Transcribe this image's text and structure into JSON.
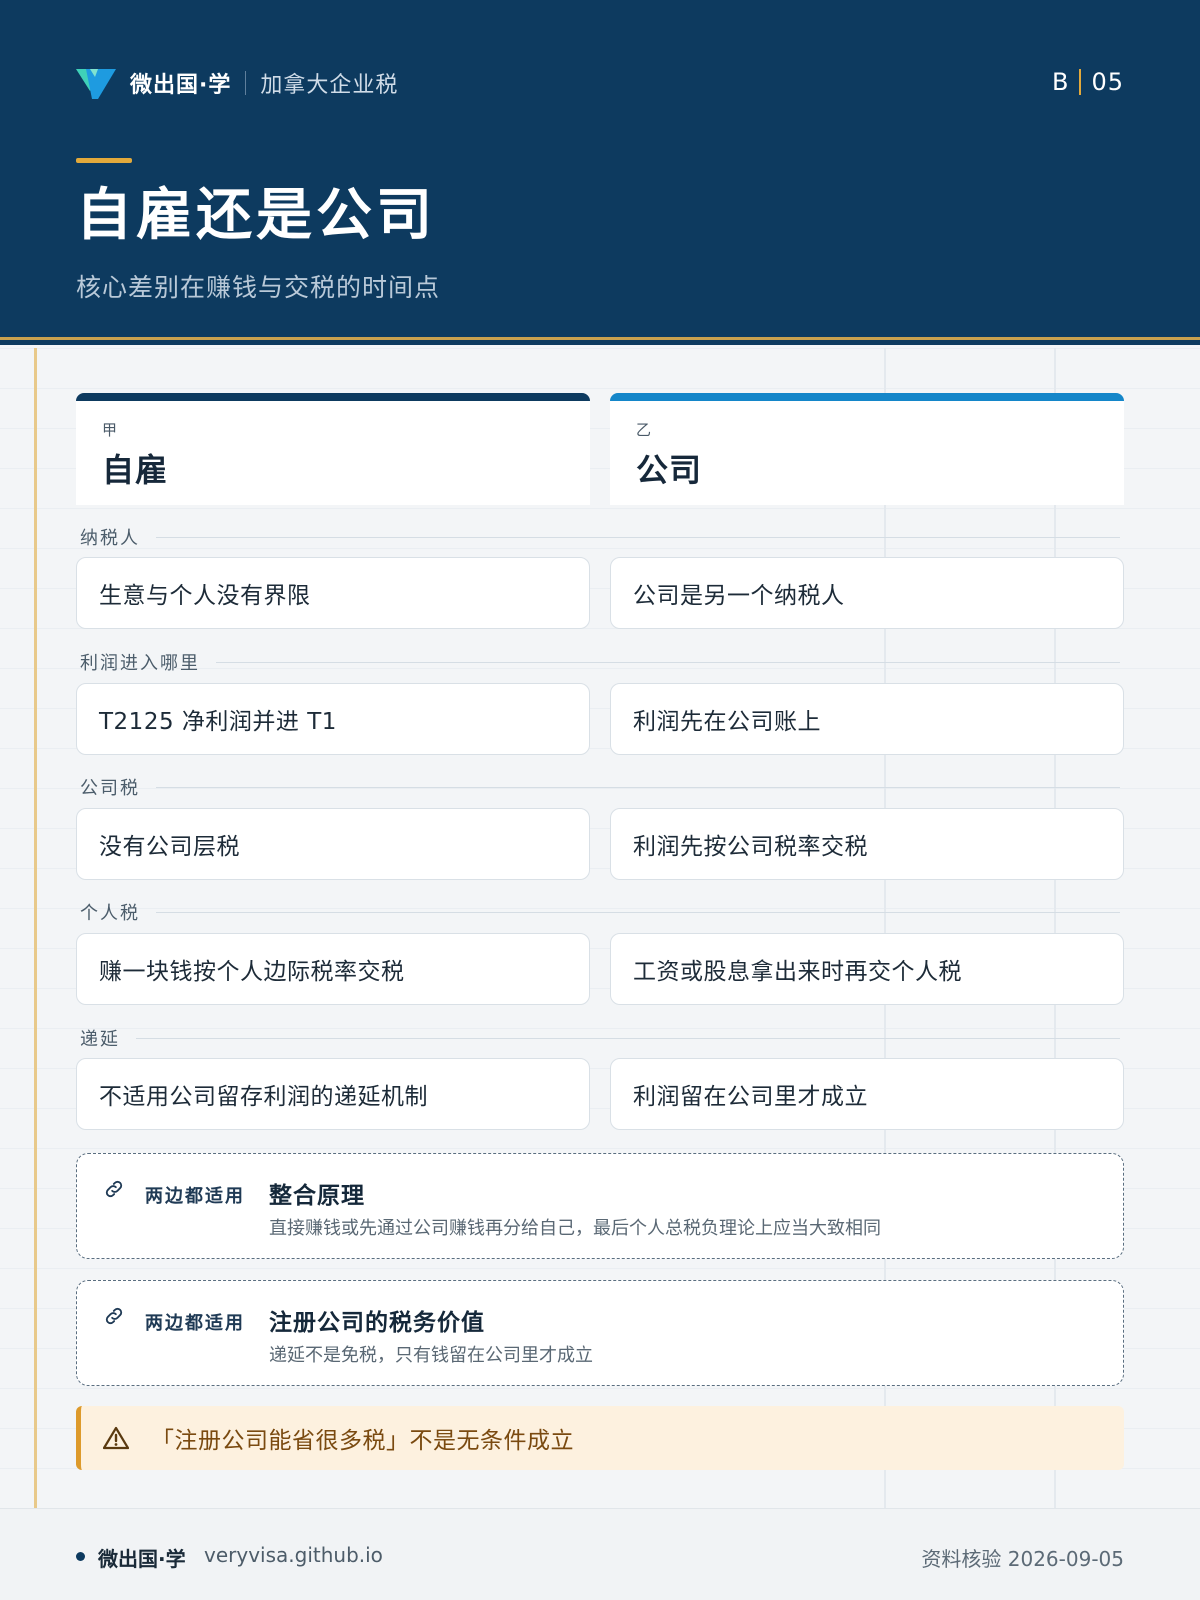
{
  "header": {
    "brand_name": "微出国·学",
    "brand_sub": "加拿大企业税",
    "series_letter": "B",
    "page_number": "05",
    "title": "自雇还是公司",
    "subtitle": "核心差别在赚钱与交税的时间点"
  },
  "columns": [
    {
      "tag": "甲",
      "title": "自雇"
    },
    {
      "tag": "乙",
      "title": "公司"
    }
  ],
  "rows": [
    {
      "label": "纳税人",
      "a": "生意与个人没有界限",
      "b": "公司是另一个纳税人"
    },
    {
      "label": "利润进入哪里",
      "a": "T2125 净利润并进 T1",
      "b": "利润先在公司账上"
    },
    {
      "label": "公司税",
      "a": "没有公司层税",
      "b": "利润先按公司税率交税"
    },
    {
      "label": "个人税",
      "a": "赚一块钱按个人边际税率交税",
      "b": "工资或股息拿出来时再交个人税"
    },
    {
      "label": "递延",
      "a": "不适用公司留存利润的递延机制",
      "b": "利润留在公司里才成立"
    }
  ],
  "notes": [
    {
      "tag": "两边都适用",
      "title": "整合原理",
      "desc": "直接赚钱或先通过公司赚钱再分给自己，最后个人总税负理论上应当大致相同",
      "icon": "link-icon"
    },
    {
      "tag": "两边都适用",
      "title": "注册公司的税务价值",
      "desc": "递延不是免税，只有钱留在公司里才成立",
      "icon": "link-icon"
    }
  ],
  "warning": {
    "text": "「注册公司能省很多税」不是无条件成立",
    "icon": "warning-icon"
  },
  "footer": {
    "brand": "微出国·学",
    "url": "veryvisa.github.io",
    "verified": "资料核验 2026-09-05"
  },
  "colors": {
    "navy": "#0d3a5f",
    "blue": "#1486c9",
    "gold": "#e2a93b",
    "warning_bg": "#fdf1df"
  }
}
